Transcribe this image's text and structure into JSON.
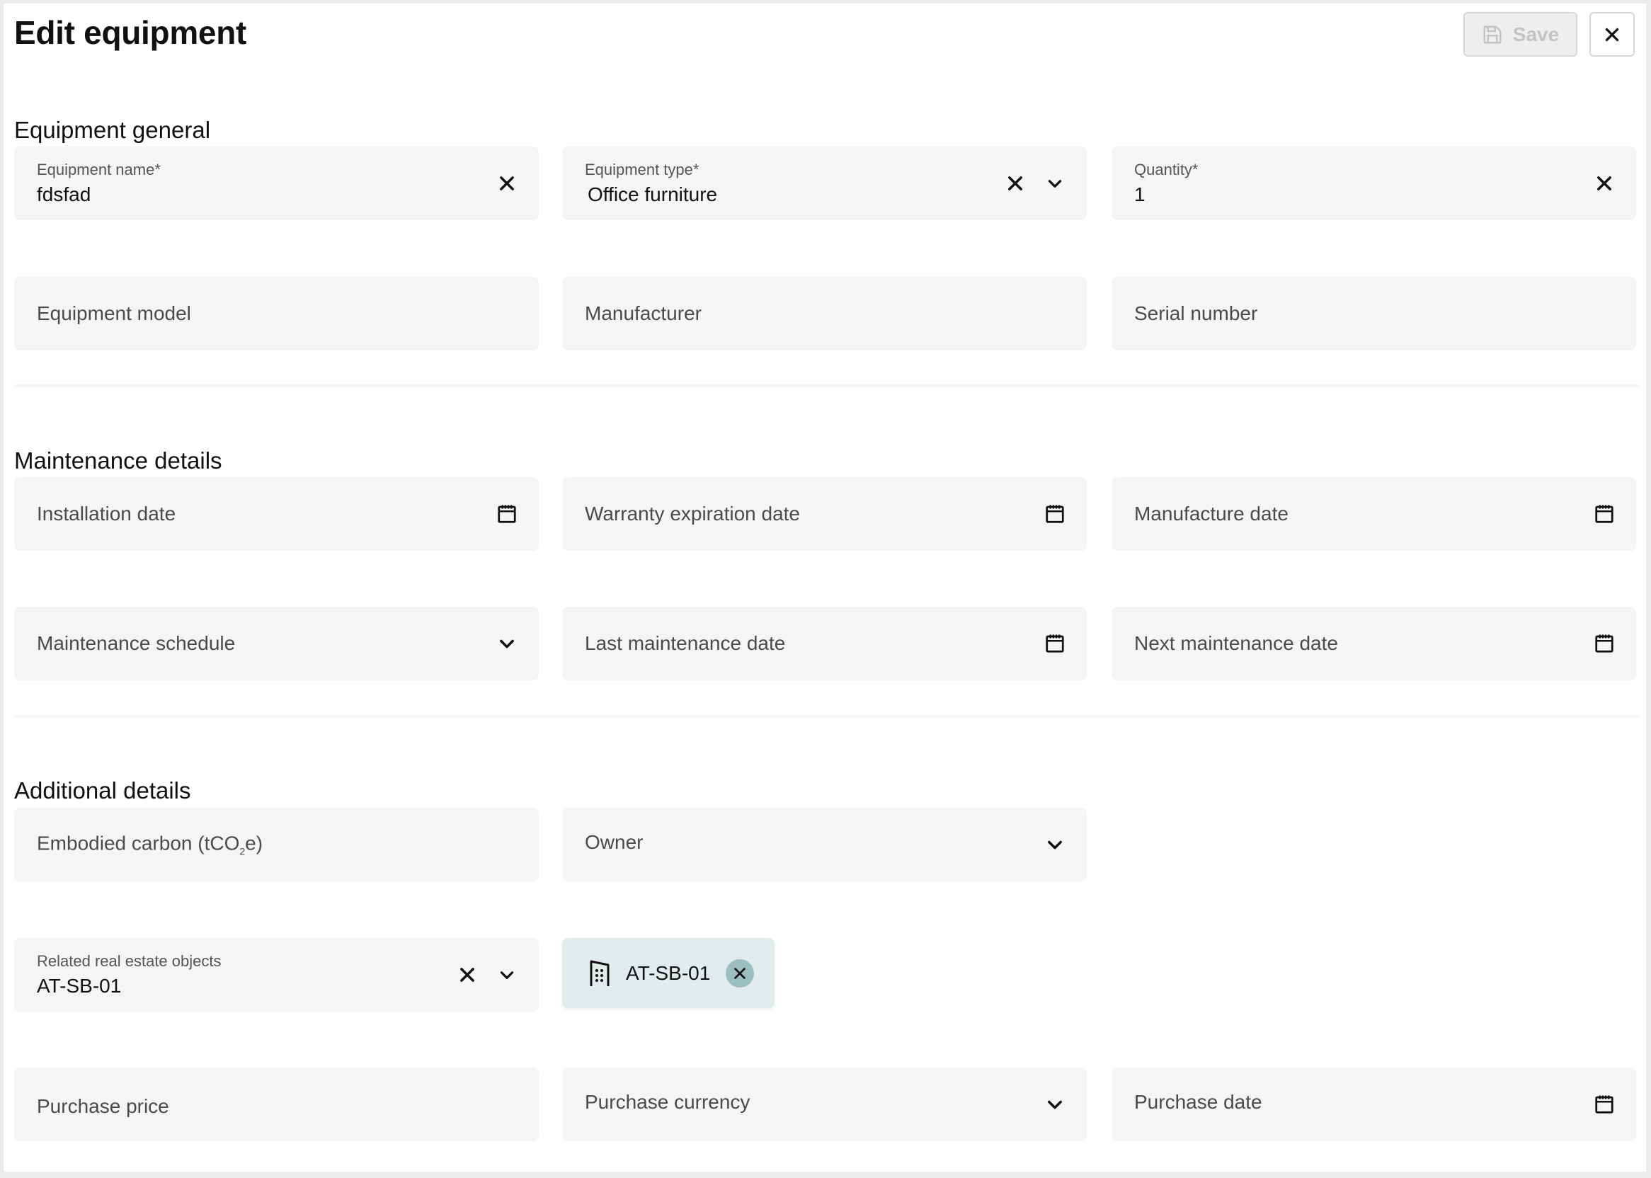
{
  "header": {
    "title": "Edit equipment",
    "save_label": "Save",
    "save_disabled": true
  },
  "sections": {
    "general": {
      "title": "Equipment general",
      "equipment_name": {
        "label": "Equipment name*",
        "value": "fdsfad"
      },
      "equipment_type": {
        "label": "Equipment type*",
        "value": "Office furniture"
      },
      "quantity": {
        "label": "Quantity*",
        "value": "1"
      },
      "equipment_model": {
        "placeholder": "Equipment model"
      },
      "manufacturer": {
        "placeholder": "Manufacturer"
      },
      "serial_number": {
        "placeholder": "Serial number"
      }
    },
    "maintenance": {
      "title": "Maintenance details",
      "installation_date": {
        "placeholder": "Installation date"
      },
      "warranty_expiration_date": {
        "placeholder": "Warranty expiration date"
      },
      "manufacture_date": {
        "placeholder": "Manufacture date"
      },
      "maintenance_schedule": {
        "placeholder": "Maintenance schedule"
      },
      "last_maintenance_date": {
        "placeholder": "Last maintenance date"
      },
      "next_maintenance_date": {
        "placeholder": "Next maintenance date"
      }
    },
    "additional": {
      "title": "Additional details",
      "embodied_carbon": {
        "placeholder_prefix": "Embodied carbon (tCO",
        "placeholder_sub": "2",
        "placeholder_suffix": "e)"
      },
      "owner": {
        "placeholder": "Owner"
      },
      "related_objects": {
        "label": "Related real estate objects",
        "value": "AT-SB-01"
      },
      "selected_chips": [
        {
          "label": "AT-SB-01",
          "icon": "building-icon"
        }
      ],
      "purchase_price": {
        "placeholder": "Purchase price"
      },
      "purchase_currency": {
        "placeholder": "Purchase currency"
      },
      "purchase_date": {
        "placeholder": "Purchase date"
      }
    }
  },
  "icons": {
    "save": "floppy-disk-icon",
    "close": "close-icon",
    "clear": "clear-x-icon",
    "dropdown": "chevron-down-icon",
    "calendar": "calendar-icon",
    "building": "building-icon"
  },
  "colors": {
    "field_bg": "#f4f6f5",
    "chip_bg": "#e3ecec",
    "chip_remove_bg": "#9bbfbf",
    "disabled_text": "#c3c3c3",
    "frame_border": "#ebebeb"
  }
}
